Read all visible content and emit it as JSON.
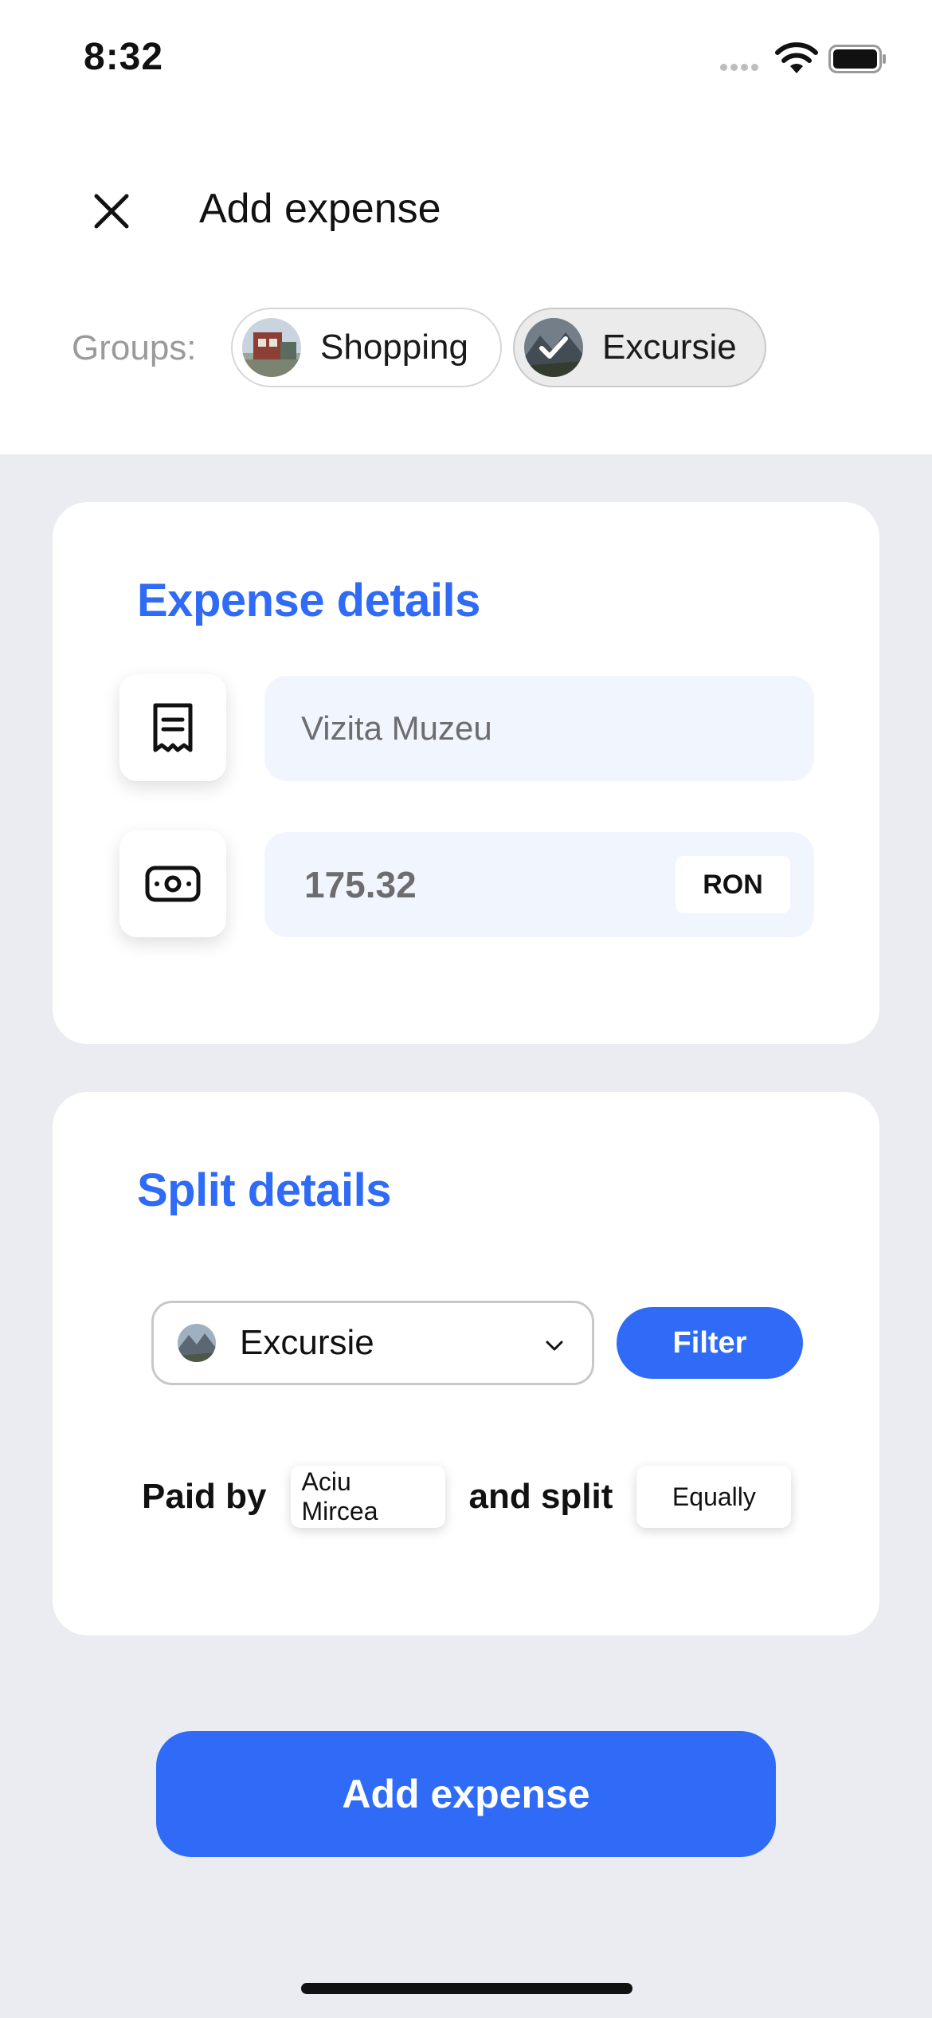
{
  "status_bar": {
    "time": "8:32"
  },
  "header": {
    "title": "Add expense"
  },
  "groups": {
    "label": "Groups:",
    "chips": [
      {
        "label": "Shopping",
        "selected": false
      },
      {
        "label": "Excursie",
        "selected": true
      }
    ]
  },
  "expense_details": {
    "title": "Expense details",
    "description": {
      "value": "Vizita Muzeu",
      "icon": "receipt-icon"
    },
    "amount": {
      "value": "175.32",
      "currency": "RON",
      "icon": "banknote-icon"
    }
  },
  "split_details": {
    "title": "Split details",
    "group_select": {
      "value": "Excursie"
    },
    "filter_label": "Filter",
    "paid_by_label": "Paid by",
    "payer": "Aciu Mircea",
    "and_split_label": "and split",
    "split_mode": "Equally"
  },
  "primary_action": {
    "label": "Add expense"
  },
  "colors": {
    "accent": "#2f6bf6",
    "background": "#ebecf2",
    "field_bg": "#f1f5fd"
  }
}
